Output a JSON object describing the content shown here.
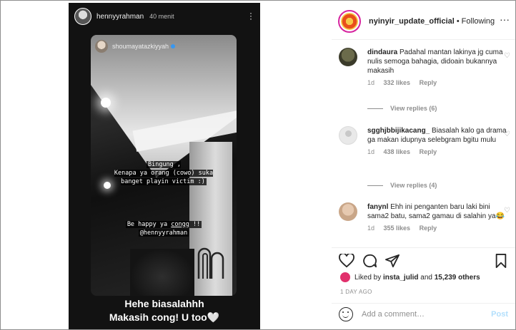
{
  "story": {
    "username": "hennyyrahman",
    "time_ago": "40 menit",
    "more_icon": "more-vertical-icon",
    "repost": {
      "username": "shoumayatazkiyyah",
      "verified": true,
      "text1": "Bingung ,\nKenapa ya orang (cowo) suka\nbanget playin victim :)",
      "text2_prefix": "Be happy ya ",
      "text2_word": "congg",
      "text2_suffix": " !!",
      "text2_mention": "@hennyyrahman"
    },
    "reply_line1": "Hehe biasalahhh",
    "reply_line2": "Makasih cong! U too🤍"
  },
  "post": {
    "owner": "nyinyir_update_official",
    "separator": "•",
    "follow_status": "Following",
    "more_icon": "more-horizontal-icon"
  },
  "comments": [
    {
      "username": "dindaura",
      "text": "Padahal mantan lakinya jg cuma nulis semoga bahagia, didoain bukannya makasih",
      "age": "1d",
      "likes": "332 likes",
      "reply": "Reply",
      "view_replies": "View replies (6)"
    },
    {
      "username": "sgghjbbijikacang_",
      "text": "Biasalah kalo ga drama ga makan idupnya selebgram bgitu mulu",
      "age": "1d",
      "likes": "438 likes",
      "reply": "Reply",
      "view_replies": "View replies (4)"
    },
    {
      "username": "fanynl",
      "text": "Ehh ini penganten baru laki bini sama2 batu, sama2 gamau di salahin ya😂",
      "age": "1d",
      "likes": "355 likes",
      "reply": "Reply"
    }
  ],
  "actions": {
    "icons": [
      "heart-icon",
      "comment-icon",
      "share-icon",
      "bookmark-icon"
    ],
    "liked_by_prefix": "Liked by ",
    "liked_by_user": "insta_julid",
    "liked_by_and": " and ",
    "liked_by_others": "15,239 others",
    "timestamp": "1 DAY AGO",
    "comment_placeholder": "Add a comment…",
    "post_label": "Post"
  }
}
